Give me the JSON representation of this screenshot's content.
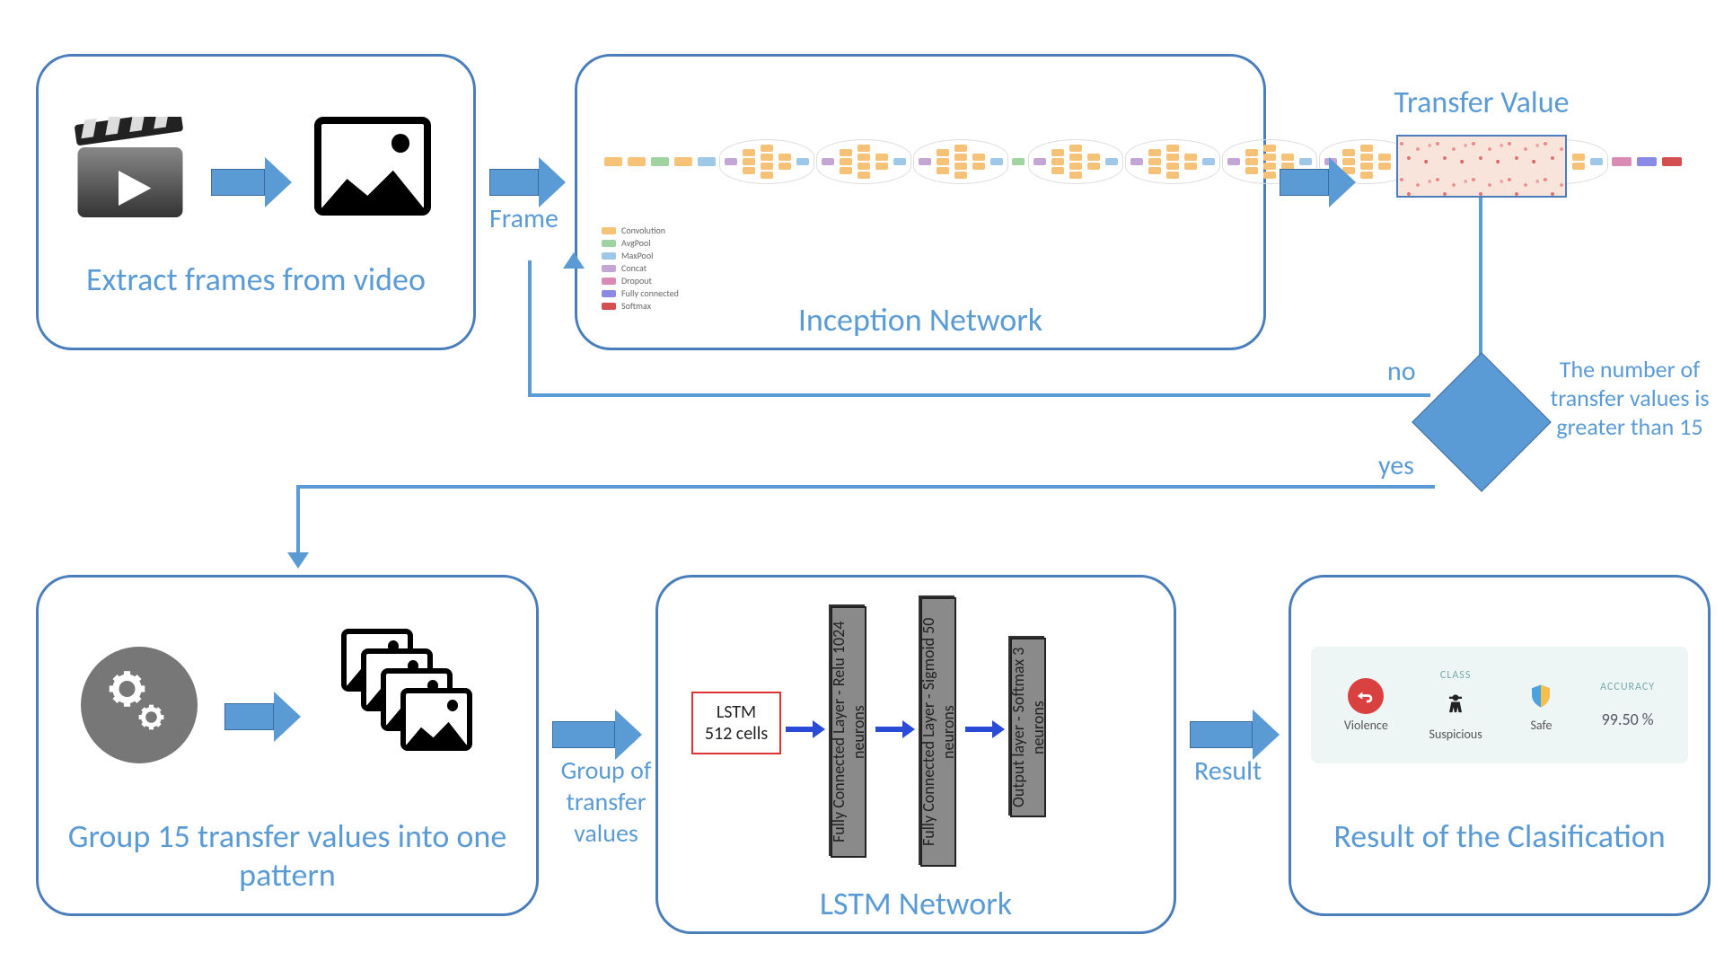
{
  "top": {
    "extract_caption": "Extract frames from video",
    "arrow1_label": "Frame",
    "inception_caption": "Inception Network",
    "transfer_label": "Transfer Value",
    "legend": [
      "Convolution",
      "AvgPool",
      "MaxPool",
      "Concat",
      "Dropout",
      "Fully connected",
      "Softmax"
    ]
  },
  "decision": {
    "text": "The number of transfer values is greater than 15",
    "yes": "yes",
    "no": "no"
  },
  "bottom": {
    "group_caption": "Group 15 transfer values into one pattern",
    "arrow_group_label": "Group of transfer values",
    "lstm_caption": "LSTM Network",
    "lstm_box": "LSTM\n512 cells",
    "layers": [
      "Fully Connected Layer - Relu 1024 neurons",
      "Fully Connected Layer - Sigmoid 50 neurons",
      "Output layer - Softmax 3 neurons"
    ],
    "arrow_result_label": "Result",
    "result_caption": "Result of the Clasification",
    "result_header_class": "CLASS",
    "result_header_acc": "ACCURACY",
    "classes": [
      "Violence",
      "Suspicious",
      "Safe"
    ],
    "accuracy": "99.50 %"
  }
}
